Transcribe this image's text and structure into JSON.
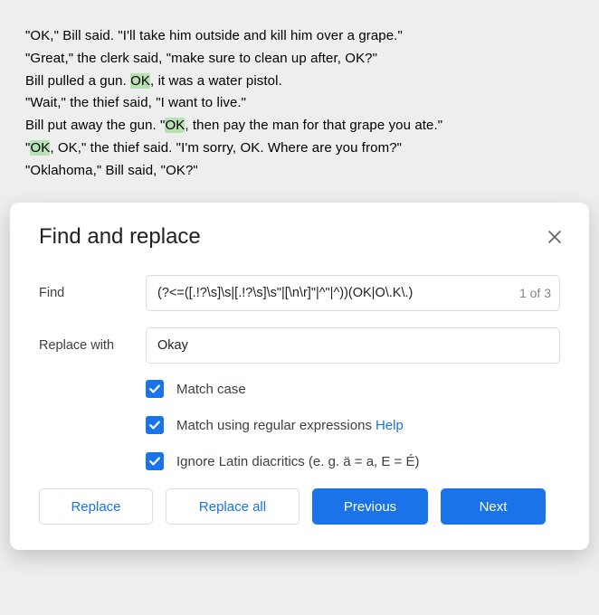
{
  "document": {
    "line1_a": "\"OK,\" Bill said. \"I'll take him outside and kill him over a grape.\"",
    "line2_a": "\"Great,\" the clerk said, \"make sure to clean up after, OK?\"",
    "line3_a": "Bill pulled a gun. ",
    "line3_hl": "OK",
    "line3_b": ", it was a water pistol.",
    "line4_a": "\"Wait,\" the thief said, \"I want to live.\"",
    "line5_a": "Bill put away the gun. \"",
    "line5_hl": "OK",
    "line5_b": ", then pay the man for that grape you ate.\"",
    "line6_a": "\"",
    "line6_hl": "OK",
    "line6_b": ", OK,\" the thief said. \"I'm sorry, OK. Where are you from?\"",
    "line7_a": "\"Oklahoma,\" Bill said, \"OK?\""
  },
  "dialog": {
    "title": "Find and replace",
    "find_label": "Find",
    "find_value": "(?<=([.!?\\s]\\s|[.!?\\s]\\s\"|[\\n\\r]\"|^\"|^))(OK|O\\.K\\.)",
    "find_counter": "1 of 3",
    "replace_label": "Replace with",
    "replace_value": "Okay",
    "check_match_case": "Match case",
    "check_regex": "Match using regular expressions",
    "help": "Help",
    "check_diacritics": "Ignore Latin diacritics (e. g. ä = a, E = É)",
    "btn_replace": "Replace",
    "btn_replace_all": "Replace all",
    "btn_previous": "Previous",
    "btn_next": "Next"
  }
}
